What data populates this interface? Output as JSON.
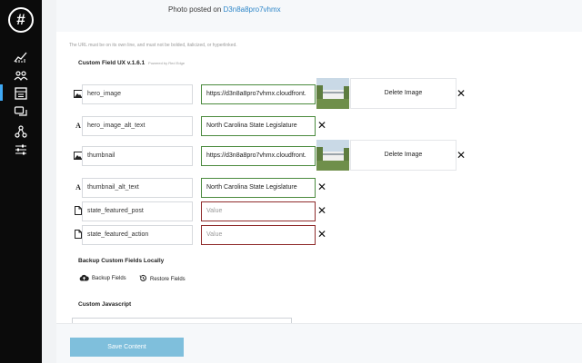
{
  "sidebar": {
    "logo_text": "#",
    "items": [
      {
        "icon": "chart-icon"
      },
      {
        "icon": "people-icon"
      },
      {
        "icon": "form-icon",
        "active": true
      },
      {
        "icon": "chat-icon"
      },
      {
        "icon": "network-icon"
      },
      {
        "icon": "sliders-icon"
      }
    ],
    "accent_color": "#3fa9f5"
  },
  "header": {
    "photo_posted_prefix": "Photo posted on",
    "photo_posted_link": "D3n8a8pro7vhmx"
  },
  "notice": "The URL must be on its own line, and must not be bolded, italicized, or hyperlinked.",
  "custom_field": {
    "title": "Custom Field UX v.1.6.1",
    "subtitle": "Powered by Red Edge",
    "rows": [
      {
        "type_icon": "image-icon",
        "name": "hero_image",
        "value": "https://d3n8a8pro7vhmx.cloudfront.",
        "status": "ok",
        "delete_label": "Delete Image"
      },
      {
        "type_icon": "text-icon",
        "type_glyph": "A",
        "name": "hero_image_alt_text",
        "value": "North Carolina State Legislature",
        "status": "ok"
      },
      {
        "type_icon": "image-icon",
        "name": "thumbnail",
        "value": "https://d3n8a8pro7vhmx.cloudfront.",
        "status": "ok",
        "delete_label": "Delete Image"
      },
      {
        "type_icon": "text-icon",
        "type_glyph": "A",
        "name": "thumbnail_alt_text",
        "value": "North Carolina State Legislature",
        "status": "ok"
      },
      {
        "type_icon": "page-icon",
        "name": "state_featured_post",
        "value": "",
        "placeholder": "Value",
        "status": "bad"
      },
      {
        "type_icon": "page-icon",
        "name": "state_featured_action",
        "value": "",
        "placeholder": "Value",
        "status": "bad"
      }
    ],
    "ok_color": "#4a8a3d",
    "bad_color": "#8f2b2b"
  },
  "backup": {
    "title": "Backup Custom Fields Locally",
    "backup_label": "Backup Fields",
    "restore_label": "Restore Fields"
  },
  "custom_js": {
    "title": "Custom Javascript"
  },
  "footer": {
    "save_label": "Save Content",
    "save_color": "#7fbfdc"
  }
}
